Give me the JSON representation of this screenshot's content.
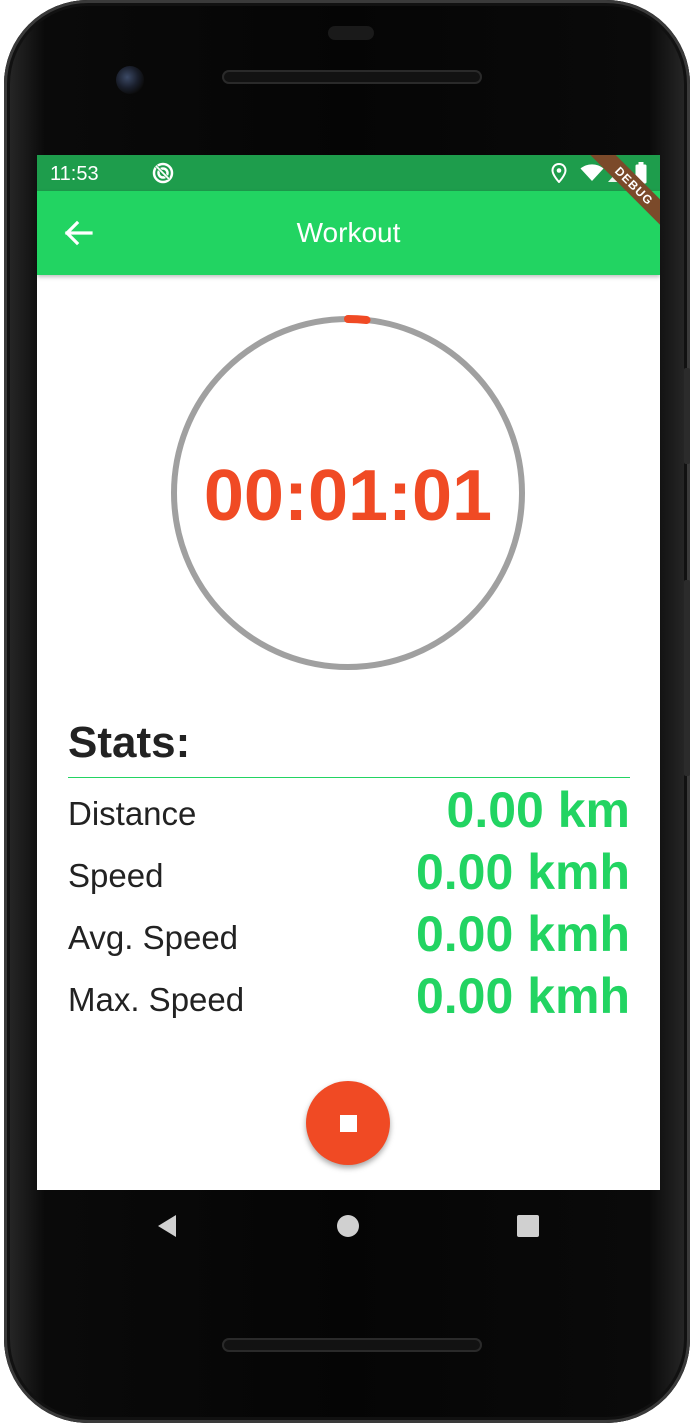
{
  "status_bar": {
    "time": "11:53",
    "icons": [
      "sync-icon",
      "location-icon",
      "wifi-icon",
      "signal-icon",
      "battery-icon"
    ]
  },
  "app_bar": {
    "title": "Workout",
    "back_icon": "arrow-back-icon",
    "debug_banner": "DEBUG"
  },
  "timer": {
    "value": "00:01:01",
    "progress": 0.017
  },
  "stats": {
    "heading": "Stats:",
    "rows": [
      {
        "label": "Distance",
        "value": "0.00 km"
      },
      {
        "label": "Speed",
        "value": "0.00 kmh"
      },
      {
        "label": "Avg. Speed",
        "value": "0.00 kmh"
      },
      {
        "label": "Max. Speed",
        "value": "0.00 kmh"
      }
    ]
  },
  "stop_button": {
    "icon": "stop-icon"
  },
  "nav": {
    "icons": [
      "nav-back-icon",
      "nav-home-icon",
      "nav-recents-icon"
    ]
  },
  "colors": {
    "status_bar": "#1e9d4c",
    "app_bar": "#22d462",
    "accent": "#f04a24",
    "value_green": "#22d462",
    "ring": "#a0a0a0",
    "debug": "#7b4a2a"
  }
}
